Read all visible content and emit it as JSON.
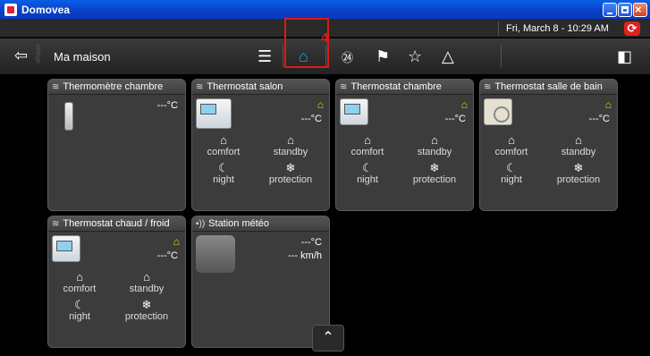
{
  "window": {
    "title": "Domovea"
  },
  "status": {
    "datetime": "Fri, March 8 - 10:29 AM",
    "sync_icon": "sync-icon"
  },
  "nav": {
    "location": "Ma maison",
    "vertical_text": "shape",
    "highlight_number": "4"
  },
  "cards": [
    {
      "title": "Thermomètre chambre",
      "kind": "thermometer",
      "temp": "---°C"
    },
    {
      "title": "Thermostat salon",
      "kind": "thermostat",
      "temp": "---°C",
      "modes": [
        "comfort",
        "standby",
        "night",
        "protection"
      ]
    },
    {
      "title": "Thermostat chambre",
      "kind": "thermostat",
      "temp": "---°C",
      "modes": [
        "comfort",
        "standby",
        "night",
        "protection"
      ]
    },
    {
      "title": "Thermostat salle de bain",
      "kind": "thermostat",
      "temp": "---°C",
      "modes": [
        "comfort",
        "standby",
        "night",
        "protection"
      ]
    },
    {
      "title": "Thermostat chaud / froid",
      "kind": "thermostat",
      "temp": "---°C",
      "modes": [
        "comfort",
        "standby",
        "night",
        "protection"
      ]
    },
    {
      "title": "Station météo",
      "kind": "weather",
      "temp": "---°C",
      "wind": "--- km/h"
    }
  ],
  "colors": {
    "accent_active": "#1fa3e6",
    "highlight": "#e01818",
    "mode_icon": "#f2d200"
  }
}
